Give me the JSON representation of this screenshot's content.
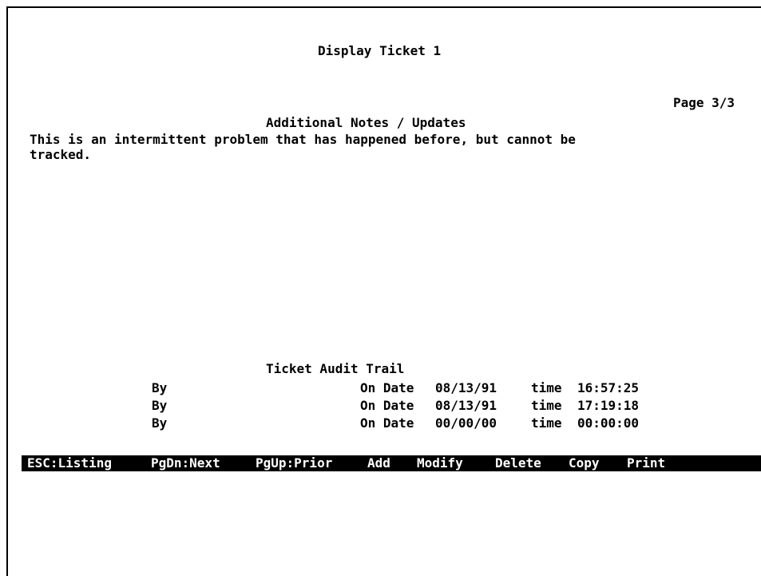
{
  "title": "Display Ticket 1",
  "page_indicator": "Page 3/3",
  "notes": {
    "heading": "Additional Notes / Updates",
    "lines": [
      "This is an intermittent problem that has happened before, but cannot be",
      "tracked."
    ]
  },
  "audit": {
    "heading": "Ticket Audit Trail",
    "rows": [
      {
        "by_label": "By",
        "on_date_label": "On Date",
        "date": "08/13/91",
        "time_label": "time",
        "time": "16:57:25"
      },
      {
        "by_label": "By",
        "on_date_label": "On Date",
        "date": "08/13/91",
        "time_label": "time",
        "time": "17:19:18"
      },
      {
        "by_label": "By",
        "on_date_label": "On Date",
        "date": "00/00/00",
        "time_label": "time",
        "time": "00:00:00"
      }
    ]
  },
  "menu": {
    "listing": "ESC:Listing",
    "next": "PgDn:Next",
    "prior": "PgUp:Prior",
    "add": "Add",
    "modify": "Modify",
    "delete": "Delete",
    "copy": "Copy",
    "print": "Print"
  },
  "colors": {
    "background": "#ffffff",
    "text": "#000000",
    "menu_bar": "#000000",
    "menu_text": "#ffffff"
  }
}
